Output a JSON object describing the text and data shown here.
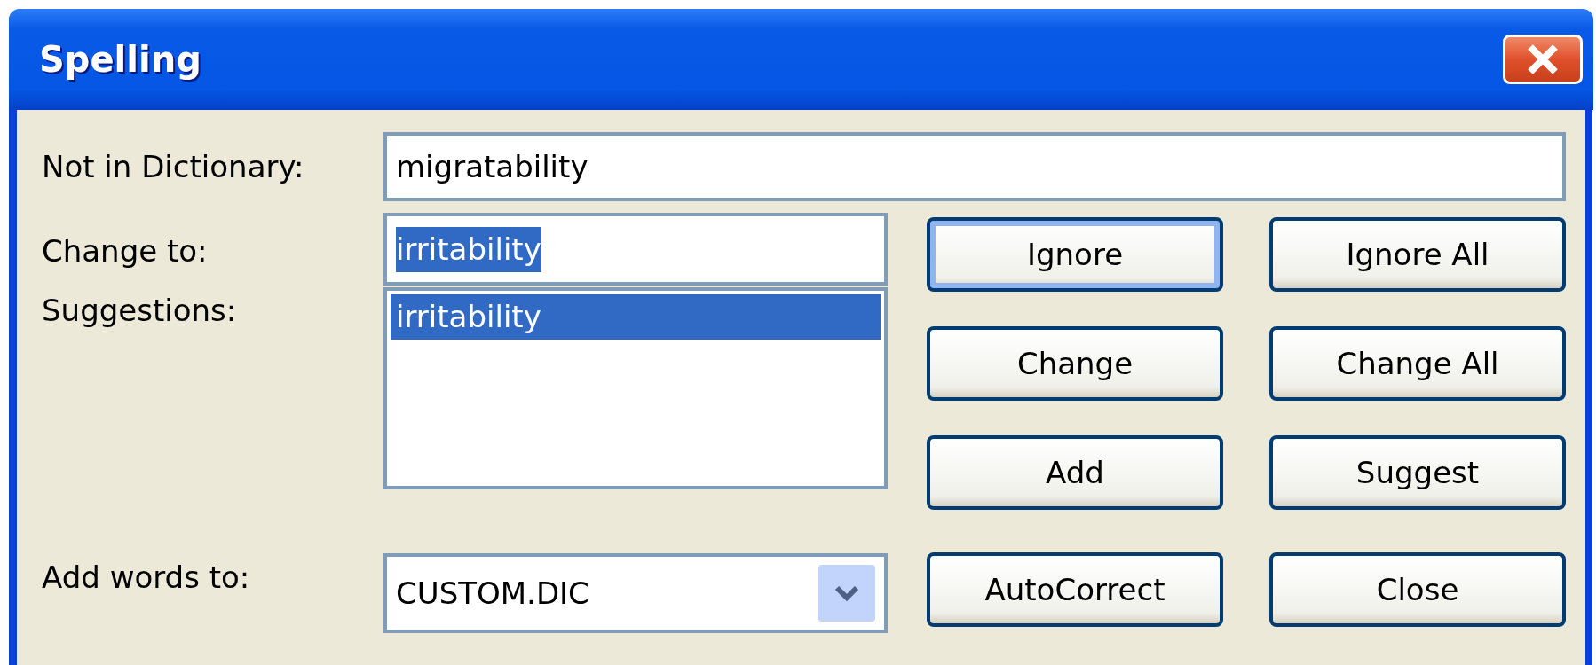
{
  "window": {
    "title": "Spelling"
  },
  "not_in_dictionary": {
    "label": "Not in Dictionary:",
    "value": "migratability"
  },
  "change_to": {
    "label": "Change to:",
    "value": "irritability",
    "text_selected": true
  },
  "suggestions": {
    "label": "Suggestions:",
    "items": [
      {
        "text": "irritability",
        "selected": true
      }
    ]
  },
  "add_words_to": {
    "label": "Add words to:",
    "value": "CUSTOM.DIC"
  },
  "buttons": [
    {
      "label": "Ignore",
      "default": true
    },
    {
      "label": "Ignore All",
      "default": false
    },
    {
      "label": "Change",
      "default": false
    },
    {
      "label": "Change All",
      "default": false
    },
    {
      "label": "Add",
      "default": false
    },
    {
      "label": "Suggest",
      "default": false
    },
    {
      "label": "AutoCorrect",
      "default": false
    },
    {
      "label": "Close",
      "default": false
    }
  ]
}
